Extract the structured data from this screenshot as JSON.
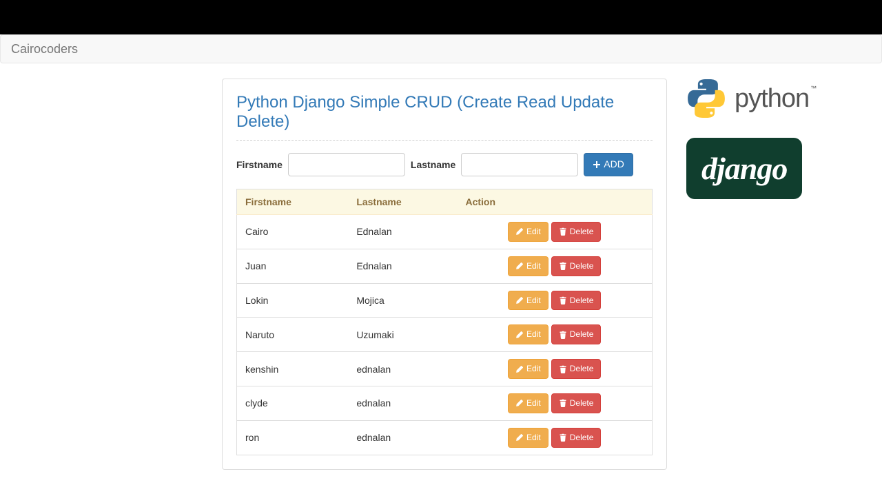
{
  "navbar": {
    "brand": "Cairocoders"
  },
  "page": {
    "title": "Python Django Simple CRUD (Create Read Update Delete)"
  },
  "form": {
    "firstname_label": "Firstname",
    "lastname_label": "Lastname",
    "add_label": "ADD"
  },
  "table": {
    "headers": {
      "firstname": "Firstname",
      "lastname": "Lastname",
      "action": "Action"
    },
    "edit_label": "Edit",
    "delete_label": "Delete",
    "rows": [
      {
        "firstname": "Cairo",
        "lastname": "Ednalan"
      },
      {
        "firstname": "Juan",
        "lastname": "Ednalan"
      },
      {
        "firstname": "Lokin",
        "lastname": "Mojica"
      },
      {
        "firstname": "Naruto",
        "lastname": "Uzumaki"
      },
      {
        "firstname": "kenshin",
        "lastname": "ednalan"
      },
      {
        "firstname": "clyde",
        "lastname": "ednalan"
      },
      {
        "firstname": "ron",
        "lastname": "ednalan"
      }
    ]
  },
  "logos": {
    "python": "python",
    "django": "django",
    "tm": "™"
  }
}
